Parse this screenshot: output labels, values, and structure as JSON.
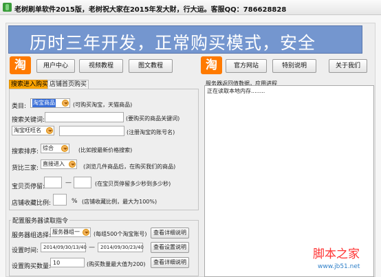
{
  "window": {
    "title": "老树刷单软件2015版，老树祝大家在2015年发大财，行大运。客服QQ：786628828"
  },
  "banner": {
    "text": "历时三年开发，正常购买模式，安全"
  },
  "logo": {
    "text": "淘"
  },
  "nav_left": [
    "用户中心",
    "视频教程",
    "图文教程"
  ],
  "nav_right": [
    "官方网站",
    "特别说明",
    "关于我们"
  ],
  "tabs": [
    "搜索进入购买",
    "店铺首页购买"
  ],
  "form": {
    "category_label": "类目:",
    "category_value": "淘宝商品",
    "category_hint": "(可购买淘宝，天猫商品)",
    "keyword_label": "搜索关键词:",
    "keyword_value": "",
    "keyword_hint": "(要购买的商品关键词)",
    "account_select": "淘宝旺旺名",
    "account_value": "",
    "account_hint": "(注册淘宝的账号名)",
    "sort_label": "搜索排序:",
    "sort_value": "综合",
    "sort_hint": "(比如按最新价格搜索)",
    "compare_label": "货比三家:",
    "compare_value": "直接进入",
    "compare_hint": "(浏览几件商品后，在购买我们的商品)",
    "dwell_label": "宝贝页停留:",
    "dwell_from": "",
    "dwell_dash": "—",
    "dwell_to": "",
    "dwell_hint": "(在宝贝页停留多少秒到多少秒)",
    "fav_label": "店铺收藏比例:",
    "fav_value": "",
    "fav_unit": "%",
    "fav_hint": "(店铺收藏比例，最大为100%)"
  },
  "server_group": {
    "title": "配置服务器读取指令",
    "group_label": "服务器组选择:",
    "group_value": "服务器组一",
    "group_hint": "(每组500个淘宝账号)",
    "detail_button": "查看详细说明",
    "time_label": "设置时间:",
    "time_from": "2014/09/30/13/40",
    "time_dash": "—",
    "time_to": "2014/09/30/23/40",
    "time_button": "查看设置说明",
    "count_label": "设置购买数量:",
    "count_value": "10",
    "count_hint": "(购买数量最大值为200)",
    "count_button": "查看详细说明"
  },
  "log": {
    "title": "服务器返回值数据，应用进程",
    "lines": [
      "正在读取本地内存........"
    ]
  },
  "watermark": {
    "text": "脚本之家",
    "url": "www.jb51.net"
  },
  "colors": {
    "banner": "#7496cf",
    "logo": "#ff7a00",
    "active_tab": "#ffa500"
  }
}
